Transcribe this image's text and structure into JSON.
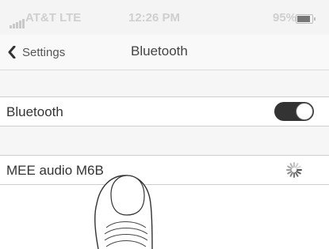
{
  "status_bar": {
    "carrier": "AT&T",
    "network": "LTE",
    "time": "12:26 PM",
    "battery": "95%",
    "battery_level": 0.95
  },
  "nav": {
    "back_label": "Settings",
    "title": "Bluetooth"
  },
  "bluetooth_row": {
    "label": "Bluetooth",
    "toggle_on": true
  },
  "devices": [
    {
      "name": "MEE audio M6B",
      "status": "connecting"
    }
  ],
  "icons": {
    "back": "chevron-left-icon",
    "spinner": "activity-spinner-icon",
    "signal": "signal-bars-icon",
    "battery": "battery-icon"
  },
  "colors": {
    "toggle_on": "#333333",
    "status_text": "#cfcfcf",
    "separator": "#cfcfcf"
  }
}
